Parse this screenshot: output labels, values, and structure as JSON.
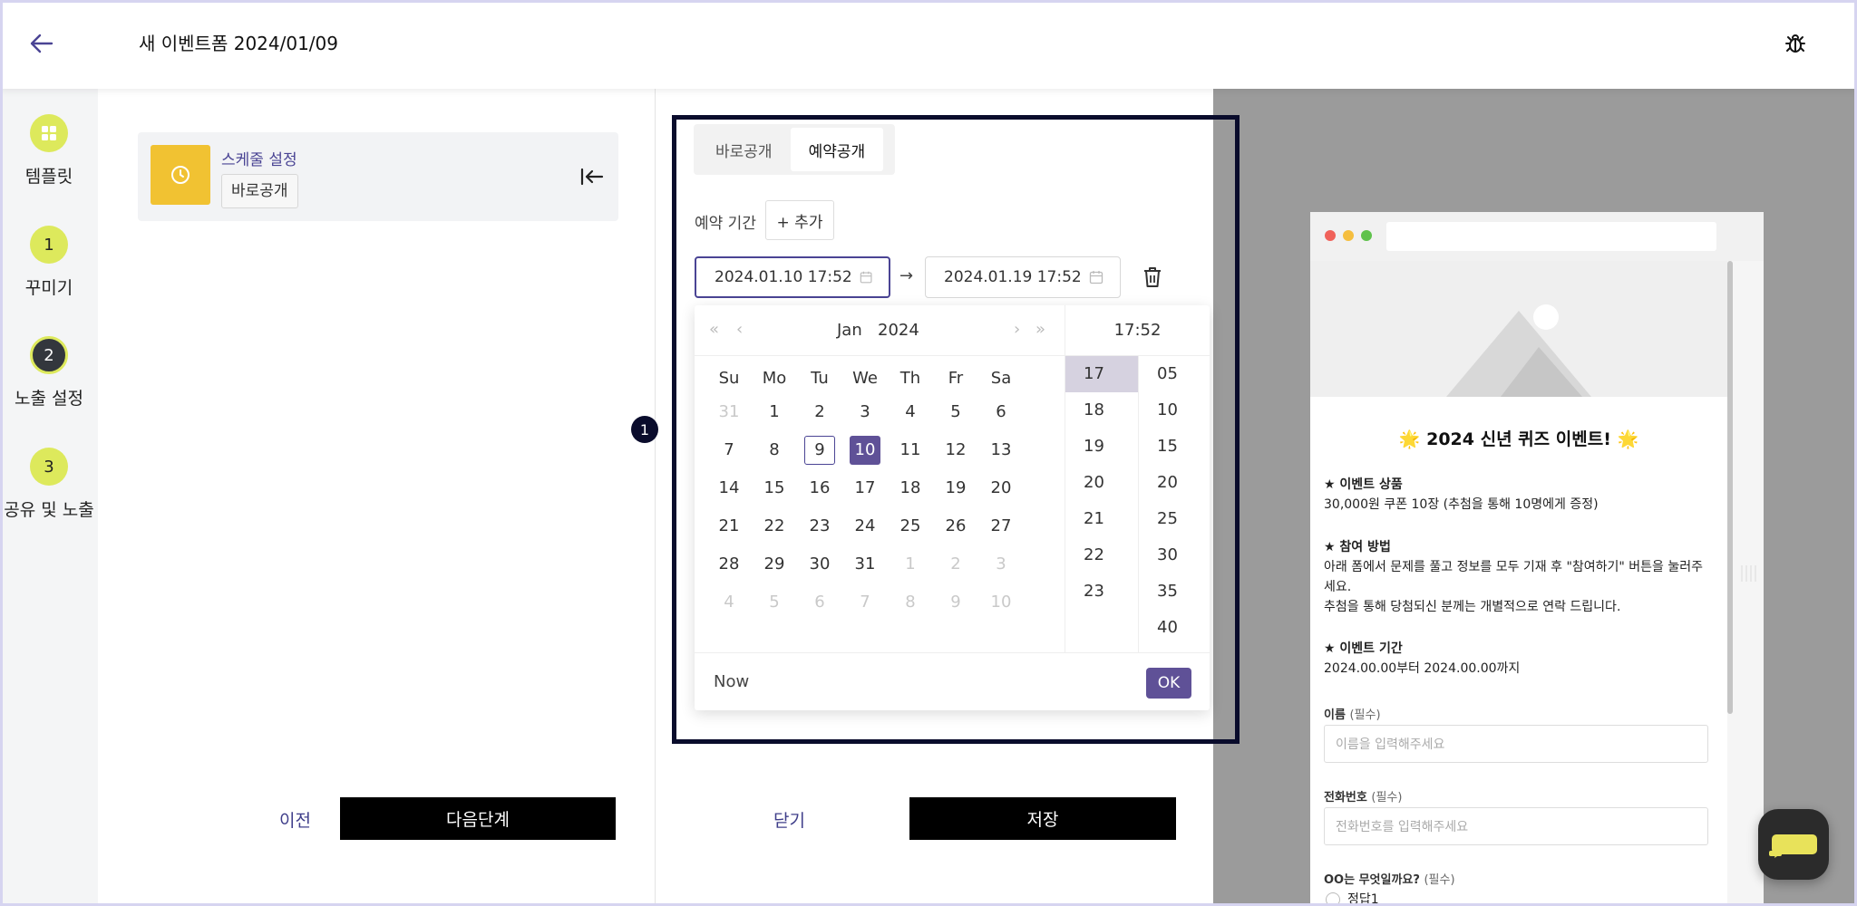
{
  "header": {
    "title": "새 이벤트폼 2024/01/09"
  },
  "sidebar": {
    "steps": [
      {
        "number": "",
        "label": "템플릿"
      },
      {
        "number": "1",
        "label": "꾸미기"
      },
      {
        "number": "2",
        "label": "노출 설정"
      },
      {
        "number": "3",
        "label": "공유 및 노출"
      }
    ]
  },
  "left_panel": {
    "schedule_title": "스케줄 설정",
    "schedule_badge": "바로공개",
    "prev_label": "이전",
    "next_label": "다음단계"
  },
  "mid_panel": {
    "tabs": [
      "바로공개",
      "예약공개"
    ],
    "active_tab": "예약공개",
    "period_label": "예약 기간",
    "add_label": "+ 추가",
    "start_value": "2024.01.10 17:52",
    "end_value": "2024.01.19 17:52",
    "arrow": "→",
    "close_label": "닫기",
    "save_label": "저장",
    "marker": "1"
  },
  "picker": {
    "nav_prev_year": "«",
    "nav_prev_month": "‹",
    "nav_next_month": "›",
    "nav_next_year": "»",
    "month": "Jan",
    "year": "2024",
    "time_header": "17:52",
    "weekdays": [
      "Su",
      "Mo",
      "Tu",
      "We",
      "Th",
      "Fr",
      "Sa"
    ],
    "weeks": [
      [
        "31",
        "1",
        "2",
        "3",
        "4",
        "5",
        "6"
      ],
      [
        "7",
        "8",
        "9",
        "10",
        "11",
        "12",
        "13"
      ],
      [
        "14",
        "15",
        "16",
        "17",
        "18",
        "19",
        "20"
      ],
      [
        "21",
        "22",
        "23",
        "24",
        "25",
        "26",
        "27"
      ],
      [
        "28",
        "29",
        "30",
        "31",
        "1",
        "2",
        "3"
      ],
      [
        "4",
        "5",
        "6",
        "7",
        "8",
        "9",
        "10"
      ]
    ],
    "today_day": "9",
    "selected_day": "10",
    "hours": [
      "17",
      "18",
      "19",
      "20",
      "21",
      "22",
      "23"
    ],
    "minutes": [
      "05",
      "10",
      "15",
      "20",
      "25",
      "30",
      "35",
      "40"
    ],
    "selected_hour": "17",
    "now_label": "Now",
    "ok_label": "OK"
  },
  "preview": {
    "title": "🌟 2024 신년 퀴즈 이벤트! 🌟",
    "prize_heading": "★ 이벤트 상품",
    "prize_text": "30,000원 쿠폰 10장 (추첨을 통해 10명에게 증정)",
    "how_heading": "★ 참여 방법",
    "how_text_1": "아래 폼에서 문제를 풀고 정보를 모두 기재 후 \"참여하기\" 버튼을 눌러주세요.",
    "how_text_2": "추첨을 통해 당첨되신 분께는 개별적으로 연락 드립니다.",
    "period_heading": "★ 이벤트 기간",
    "period_text": "2024.00.00부터 2024.00.00까지",
    "name_label": "이름",
    "name_required": "(필수)",
    "name_placeholder": "이름을 입력해주세요",
    "phone_label": "전화번호",
    "phone_required": "(필수)",
    "phone_placeholder": "전화번호를 입력해주세요",
    "quiz_label": "OO는 무엇일까요?",
    "quiz_required": "(필수)",
    "quiz_option": "정답1"
  },
  "colors": {
    "accent": "#5f5197",
    "step_badge": "#dde95c",
    "schedule_icon": "#f1c232",
    "highlight_border": "#0a0c2c"
  }
}
